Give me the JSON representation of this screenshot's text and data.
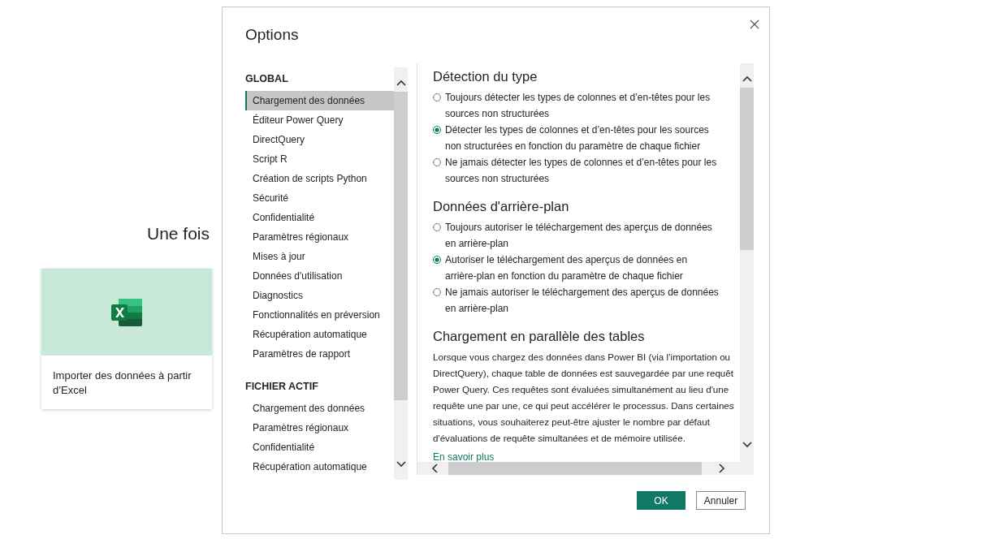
{
  "background": {
    "heading": "Une fois",
    "card": {
      "title": "Importer des données à partir d’Excel"
    }
  },
  "dialog": {
    "title": "Options",
    "nav": {
      "sections": [
        {
          "heading": "GLOBAL",
          "items": [
            {
              "label": "Chargement des données",
              "selected": true
            },
            {
              "label": "Éditeur Power Query",
              "selected": false
            },
            {
              "label": "DirectQuery",
              "selected": false
            },
            {
              "label": "Script R",
              "selected": false
            },
            {
              "label": "Création de scripts Python",
              "selected": false
            },
            {
              "label": "Sécurité",
              "selected": false
            },
            {
              "label": "Confidentialité",
              "selected": false
            },
            {
              "label": "Paramètres régionaux",
              "selected": false
            },
            {
              "label": "Mises à jour",
              "selected": false
            },
            {
              "label": "Données d'utilisation",
              "selected": false
            },
            {
              "label": "Diagnostics",
              "selected": false
            },
            {
              "label": "Fonctionnalités en préversion",
              "selected": false
            },
            {
              "label": "Récupération automatique",
              "selected": false
            },
            {
              "label": "Paramètres de rapport",
              "selected": false
            }
          ]
        },
        {
          "heading": "FICHIER ACTIF",
          "items": [
            {
              "label": "Chargement des données",
              "selected": false
            },
            {
              "label": "Paramètres régionaux",
              "selected": false
            },
            {
              "label": "Confidentialité",
              "selected": false
            },
            {
              "label": "Récupération automatique",
              "selected": false
            }
          ]
        }
      ]
    },
    "content": {
      "groups": [
        {
          "title": "Détection du type",
          "options": [
            {
              "label": "Toujours détecter les types de colonnes et d’en-têtes pour les sources non structurées",
              "selected": false
            },
            {
              "label": "Détecter les types de colonnes et d’en-têtes pour les sources non structurées en fonction du paramètre de chaque fichier",
              "selected": true
            },
            {
              "label": "Ne jamais détecter les types de colonnes et d’en-têtes pour les sources non structurées",
              "selected": false
            }
          ]
        },
        {
          "title": "Données d'arrière-plan",
          "options": [
            {
              "label": "Toujours autoriser le téléchargement des aperçus de données en arrière-plan",
              "selected": false
            },
            {
              "label": "Autoriser le téléchargement des aperçus de données en arrière-plan en fonction du paramètre de chaque fichier",
              "selected": true
            },
            {
              "label": "Ne jamais autoriser le téléchargement des aperçus de données en arrière-plan",
              "selected": false
            }
          ]
        }
      ],
      "section": {
        "title": "Chargement en parallèle des tables",
        "paragraph_lines": [
          "Lorsque vous chargez des données dans Power BI (via l’importation ou",
          "DirectQuery), chaque table de données est sauvegardée par une requêt",
          "Power Query. Ces requêtes sont évaluées simultanément au lieu d'une",
          "requête une par une, ce qui peut accélérer le processus. Dans certaines",
          "situations, vous souhaiterez peut-être ajuster le nombre par défaut",
          "d'évaluations de requête simultanées et de mémoire utilisée."
        ],
        "link": "En savoir plus"
      }
    },
    "buttons": [
      {
        "label": "OK",
        "kind": "primary"
      },
      {
        "label": "Annuler",
        "kind": "secondary"
      }
    ]
  }
}
